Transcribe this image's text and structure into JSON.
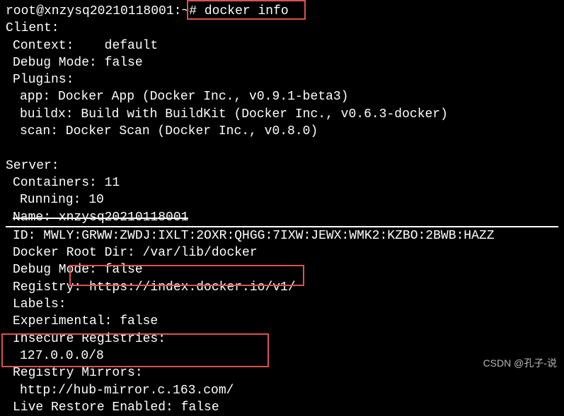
{
  "prompt": "root@xnzysq20210118001:~#",
  "command": "docker info",
  "client": {
    "header": "Client:",
    "context_label": "Context:",
    "context_value": "default",
    "debug_label": "Debug Mode:",
    "debug_value": "false",
    "plugins_label": "Plugins:",
    "plugins": {
      "app": "app: Docker App (Docker Inc., v0.9.1-beta3)",
      "buildx": "buildx: Build with BuildKit (Docker Inc., v0.6.3-docker)",
      "scan": "scan: Docker Scan (Docker Inc., v0.8.0)"
    }
  },
  "server": {
    "header": "Server:",
    "containers": "Containers: 11",
    "running": "Running: 10",
    "name_strike": "Name: xnzysq20210118001",
    "id": "ID: MWLY:GRWW:ZWDJ:IXLT:2OXR:QHGG:7IXW:JEWX:WMK2:KZBO:2BWB:HAZZ",
    "root_dir": "Docker Root Dir: /var/lib/docker",
    "debug_mode": "Debug Mode: false",
    "registry": "Registry: https://index.docker.io/v1/",
    "labels": "Labels:",
    "experimental": "Experimental: false",
    "insecure_header": "Insecure Registries:",
    "insecure_value": "127.0.0.0/8",
    "mirrors_header": "Registry Mirrors:",
    "mirrors_value": "http://hub-mirror.c.163.com/",
    "live_restore": "Live Restore Enabled: false"
  },
  "watermark": "CSDN @孔子-说"
}
